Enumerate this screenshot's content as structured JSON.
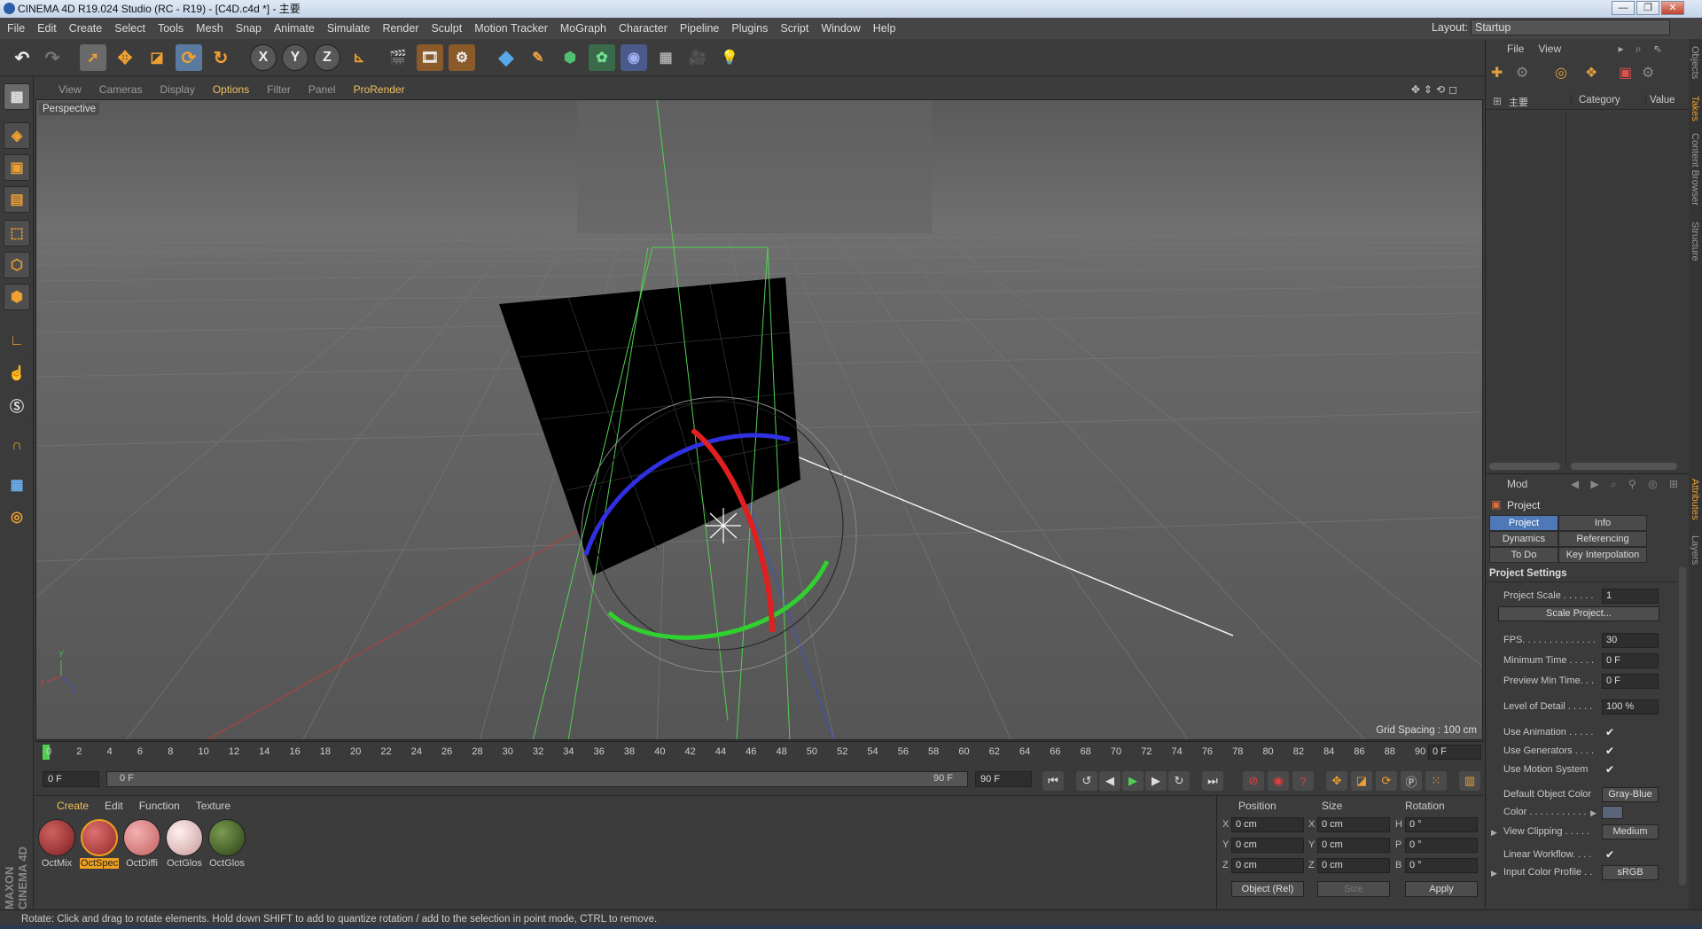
{
  "window": {
    "title": "CINEMA 4D R19.024 Studio (RC - R19) - [C4D.c4d *] - 主要",
    "buttons": [
      "—",
      "❐",
      "✕"
    ]
  },
  "menubar": {
    "items": [
      "File",
      "Edit",
      "Create",
      "Select",
      "Tools",
      "Mesh",
      "Snap",
      "Animate",
      "Simulate",
      "Render",
      "Sculpt",
      "Motion Tracker",
      "MoGraph",
      "Character",
      "Pipeline",
      "Plugins",
      "Script",
      "Window",
      "Help"
    ],
    "layout_label": "Layout:",
    "layout_value": "Startup"
  },
  "toolbar": {
    "axis_x": "X",
    "axis_y": "Y",
    "axis_z": "Z"
  },
  "viewport": {
    "menu": [
      "View",
      "Cameras",
      "Display",
      "Options",
      "Filter",
      "Panel",
      "ProRender"
    ],
    "highlighted_menu": "Options",
    "label": "Perspective",
    "grid_spacing": "Grid Spacing : 100 cm"
  },
  "timeline": {
    "ticks": [
      "0",
      "2",
      "4",
      "6",
      "8",
      "10",
      "12",
      "14",
      "16",
      "18",
      "20",
      "22",
      "24",
      "26",
      "28",
      "30",
      "32",
      "34",
      "36",
      "38",
      "40",
      "42",
      "44",
      "46",
      "48",
      "50",
      "52",
      "54",
      "56",
      "58",
      "60",
      "62",
      "64",
      "66",
      "68",
      "70",
      "72",
      "74",
      "76",
      "78",
      "80",
      "82",
      "84",
      "86",
      "88",
      "90"
    ],
    "current_frame": "0 F"
  },
  "transport": {
    "start_field": "0 F",
    "range_start": "0 F",
    "range_end": "90 F",
    "end_field": "90 F"
  },
  "materials": {
    "menu": [
      "Create",
      "Edit",
      "Function",
      "Texture"
    ],
    "items": [
      {
        "name": "OctMix",
        "color": "#9a3a38",
        "selected": false
      },
      {
        "name": "OctSpec",
        "color": "#b04848",
        "selected": true
      },
      {
        "name": "OctDiffi",
        "color": "#d88a8a",
        "selected": false
      },
      {
        "name": "OctGlos",
        "color": "#e8c4c4",
        "selected": false
      },
      {
        "name": "OctGlos",
        "color": "#4a6a30",
        "selected": false
      }
    ]
  },
  "coords": {
    "headers": {
      "position": "Position",
      "size": "Size",
      "rotation": "Rotation"
    },
    "rows": [
      {
        "pl": "X",
        "pv": "0 cm",
        "sl": "X",
        "sv": "0 cm",
        "rl": "H",
        "rv": "0 °"
      },
      {
        "pl": "Y",
        "pv": "0 cm",
        "sl": "Y",
        "sv": "0 cm",
        "rl": "P",
        "rv": "0 °"
      },
      {
        "pl": "Z",
        "pv": "0 cm",
        "sl": "Z",
        "sv": "0 cm",
        "rl": "B",
        "rv": "0 °"
      }
    ],
    "mode": "Object (Rel)",
    "size_mode": "Size",
    "apply": "Apply"
  },
  "status": "Rotate: Click and drag to rotate elements. Hold down SHIFT to add to quantize rotation / add to the selection in point mode, CTRL to remove.",
  "objects": {
    "menu": [
      "File",
      "View"
    ],
    "col_name": "主要",
    "col_category": "Category",
    "col_value": "Value"
  },
  "attributes": {
    "mode": "Mod",
    "object": "Project",
    "tabs": [
      "Project Settings",
      "Info",
      "Dynamics",
      "Referencing",
      "To Do",
      "Key Interpolation"
    ],
    "section": "Project Settings",
    "project_scale_label": "Project Scale . . . . . .",
    "project_scale": "1",
    "scale_project_btn": "Scale Project...",
    "fps_label": "FPS. . . . . . . . . . . . . .",
    "fps": "30",
    "min_time_label": "Minimum Time . . . . .",
    "min_time": "0 F",
    "preview_min_label": "Preview Min Time. . .",
    "preview_min": "0 F",
    "lod_label": "Level of Detail . . . . .",
    "lod": "100 %",
    "use_anim_label": "Use Animation . . . . .",
    "use_gen_label": "Use Generators . . . .",
    "use_motion_label": "Use Motion System",
    "default_color_label": "Default Object Color",
    "default_color": "Gray-Blue",
    "color_label": "Color . . . . . . . . . . .",
    "view_clip_label": "View Clipping . . . . .",
    "view_clip": "Medium",
    "linear_wf_label": "Linear Workflow. . . .",
    "input_profile_label": "Input Color Profile . .",
    "input_profile": "sRGB"
  },
  "sidetabs": [
    "Objects",
    "Takes",
    "Content Browser",
    "Structure",
    "Attributes",
    "Layers"
  ],
  "brand": "MAXON CINEMA 4D"
}
